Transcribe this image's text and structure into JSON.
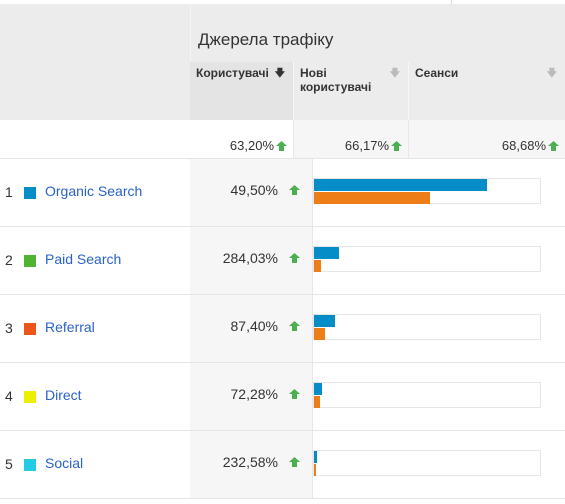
{
  "table": {
    "group_title": "Джерела трафіку",
    "columns": [
      {
        "label": "Користувачі",
        "sort": "active",
        "sort_icon": "arrow-down-icon"
      },
      {
        "label": "Нові користувачі",
        "sort": "inactive",
        "sort_icon": "arrow-down-icon"
      },
      {
        "label": "Сеанси",
        "sort": "inactive",
        "sort_icon": "arrow-down-icon"
      }
    ],
    "summary": [
      {
        "value": "63,20%",
        "trend": "up"
      },
      {
        "value": "66,17%",
        "trend": "up"
      },
      {
        "value": "68,68%",
        "trend": "up"
      }
    ],
    "rows": [
      {
        "rank": "1",
        "source": "Organic Search",
        "swatch_color": "#058dc7",
        "users_change": "49,50%",
        "trend": "up",
        "bar_blue": 0.76,
        "bar_orange": 0.51
      },
      {
        "rank": "2",
        "source": "Paid Search",
        "swatch_color": "#50b432",
        "users_change": "284,03%",
        "trend": "up",
        "bar_blue": 0.11,
        "bar_orange": 0.03
      },
      {
        "rank": "3",
        "source": "Referral",
        "swatch_color": "#ed561b",
        "users_change": "87,40%",
        "trend": "up",
        "bar_blue": 0.09,
        "bar_orange": 0.05
      },
      {
        "rank": "4",
        "source": "Direct",
        "swatch_color": "#edef00",
        "users_change": "72,28%",
        "trend": "up",
        "bar_blue": 0.035,
        "bar_orange": 0.025
      },
      {
        "rank": "5",
        "source": "Social",
        "swatch_color": "#24cbe5",
        "users_change": "232,58%",
        "trend": "up",
        "bar_blue": 0.012,
        "bar_orange": 0.008
      }
    ]
  },
  "colors": {
    "trend_up": "#4caf50",
    "bar_primary": "#058dc7",
    "bar_secondary": "#ed7e17",
    "link": "#2962c8"
  }
}
